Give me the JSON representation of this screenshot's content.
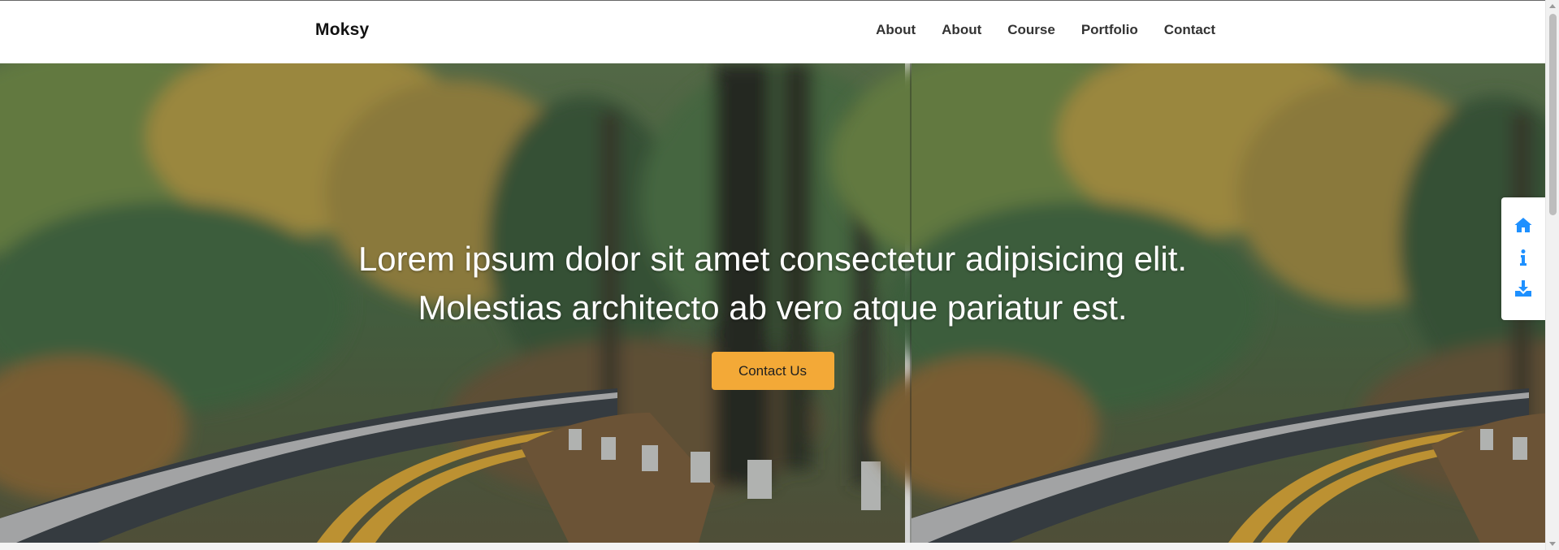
{
  "nav": {
    "brand": "Moksy",
    "links": [
      "About",
      "About",
      "Course",
      "Portfolio",
      "Contact"
    ]
  },
  "hero": {
    "line1": "Lorem ipsum dolor sit amet consectetur adipisicing elit.",
    "line2": "Molestias architecto ab vero atque pariatur est.",
    "cta_label": "Contact Us"
  },
  "dock": {
    "icons": [
      "home-icon",
      "info-icon",
      "download-icon"
    ],
    "icon_color": "#1e90ff"
  },
  "colors": {
    "accent": "#f3a937",
    "nav_bg": "#ffffff",
    "nav_text": "#333333"
  }
}
